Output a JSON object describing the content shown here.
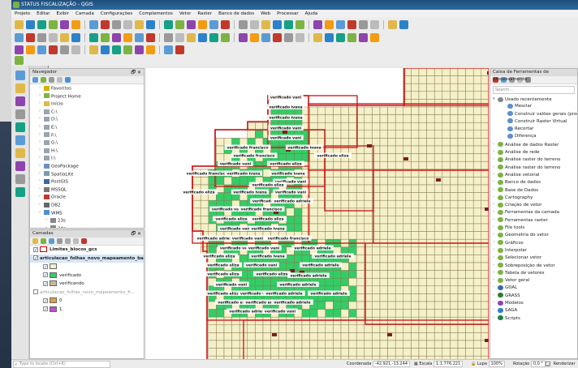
{
  "window": {
    "title": "STATUS FISCALIZAÇÃO - QGIS"
  },
  "menu": [
    "Projeto",
    "Editar",
    "Exibir",
    "Camada",
    "Configurações",
    "Complementos",
    "Vetor",
    "Raster",
    "Banco de dados",
    "Web",
    "Processar",
    "Ajuda"
  ],
  "navigator": {
    "title": "Navegador",
    "items": [
      {
        "label": "Favoritos",
        "icon": "star-icon",
        "color": "#d9b000",
        "level": 1
      },
      {
        "label": "Project Home",
        "icon": "home-folder-icon",
        "color": "#7cb342",
        "level": 1
      },
      {
        "label": "Início",
        "icon": "folder-icon",
        "color": "#e0b84a",
        "level": 1
      },
      {
        "label": "C:\\",
        "icon": "drive-icon",
        "color": "#9aa4ae",
        "level": 1
      },
      {
        "label": "D:\\",
        "icon": "drive-icon",
        "color": "#9aa4ae",
        "level": 1
      },
      {
        "label": "E:\\",
        "icon": "drive-icon",
        "color": "#9aa4ae",
        "level": 1
      },
      {
        "label": "F:\\",
        "icon": "drive-icon",
        "color": "#9aa4ae",
        "level": 1
      },
      {
        "label": "G:\\",
        "icon": "drive-icon",
        "color": "#9aa4ae",
        "level": 1
      },
      {
        "label": "H:\\",
        "icon": "drive-icon",
        "color": "#9aa4ae",
        "level": 1
      },
      {
        "label": "I:\\",
        "icon": "drive-icon",
        "color": "#9aa4ae",
        "level": 1
      },
      {
        "label": "GeoPackage",
        "icon": "geopackage-icon",
        "color": "#6b8fc7",
        "level": 1
      },
      {
        "label": "SpatiaLite",
        "icon": "spatialite-icon",
        "color": "#7b9bb0",
        "level": 1
      },
      {
        "label": "PostGIS",
        "icon": "postgis-icon",
        "color": "#3a6aa3",
        "level": 1
      },
      {
        "label": "MSSQL",
        "icon": "mssql-icon",
        "color": "#777777",
        "level": 1
      },
      {
        "label": "Oracle",
        "icon": "oracle-icon",
        "color": "#c0392b",
        "level": 1
      },
      {
        "label": "DB2",
        "icon": "db2-icon",
        "color": "#666666",
        "level": 1
      },
      {
        "label": "WMS",
        "icon": "globe-icon",
        "color": "#4a90d9",
        "level": 1
      },
      {
        "label": "23s",
        "icon": "layer-icon",
        "color": "#888888",
        "level": 2
      },
      {
        "label": "24s",
        "icon": "layer-icon",
        "color": "#888888",
        "level": 2
      }
    ]
  },
  "layers_panel": {
    "title": "Camadas",
    "layers": [
      {
        "label": "Limites_blocos_gcs",
        "checked": true,
        "swatch": "#ffffff",
        "border": "#c00000",
        "level": 0,
        "bold": true
      },
      {
        "label": "articulacao_folhas_novo_mapeamento_ba",
        "checked": true,
        "swatch": null,
        "level": 0,
        "bold": true
      },
      {
        "label": "",
        "checked": true,
        "swatch": "#f4f0c8",
        "level": 1
      },
      {
        "label": "verificado",
        "checked": true,
        "swatch": "#33cc66",
        "level": 1
      },
      {
        "label": "verificando",
        "checked": true,
        "swatch": "#c9b896",
        "level": 1
      },
      {
        "label": "articulacao_folhas_novo_mapeamento_fi...",
        "checked": false,
        "swatch": null,
        "level": 0,
        "bold": false,
        "muted": true
      },
      {
        "label": "0",
        "checked": true,
        "swatch": "#e0a040",
        "level": 1
      },
      {
        "label": "1",
        "checked": true,
        "swatch": "#c050d0",
        "level": 1
      }
    ]
  },
  "toolbox": {
    "title": "Caixa de Ferramentas de processamento",
    "search_placeholder": "Search...",
    "items": [
      {
        "label": "Usado recentemente",
        "level": 0,
        "icon": "recent-icon",
        "color": "#888888",
        "open": true
      },
      {
        "label": "Mesclar",
        "level": 1,
        "icon": "tool-icon",
        "color": "#5b8fd0"
      },
      {
        "label": "Construir valões gerais (proced)",
        "level": 1,
        "icon": "tool-icon",
        "color": "#5b8fd0"
      },
      {
        "label": "Construir Raster Virtual",
        "level": 1,
        "icon": "tool-icon",
        "color": "#5b8fd0"
      },
      {
        "label": "Recortar",
        "level": 1,
        "icon": "tool-icon",
        "color": "#5b8fd0"
      },
      {
        "label": "Diferença",
        "level": 1,
        "icon": "tool-icon",
        "color": "#5b8fd0"
      },
      {
        "label": "Análise de dados Raster",
        "level": 0,
        "icon": "qgis-icon",
        "color": "#7cb342"
      },
      {
        "label": "Análise de rede",
        "level": 0,
        "icon": "qgis-icon",
        "color": "#7cb342"
      },
      {
        "label": "Análise raster do terreno",
        "level": 0,
        "icon": "qgis-icon",
        "color": "#7cb342"
      },
      {
        "label": "Análise raster do terreno",
        "level": 0,
        "icon": "qgis-icon",
        "color": "#7cb342"
      },
      {
        "label": "Análise vetorial",
        "level": 0,
        "icon": "qgis-icon",
        "color": "#7cb342"
      },
      {
        "label": "Banco de dados",
        "level": 0,
        "icon": "qgis-icon",
        "color": "#7cb342"
      },
      {
        "label": "Base de Dados",
        "level": 0,
        "icon": "qgis-icon",
        "color": "#7cb342"
      },
      {
        "label": "Cartography",
        "level": 0,
        "icon": "qgis-icon",
        "color": "#7cb342"
      },
      {
        "label": "Criação de vetor",
        "level": 0,
        "icon": "qgis-icon",
        "color": "#7cb342"
      },
      {
        "label": "Ferramentas da camada",
        "level": 0,
        "icon": "qgis-icon",
        "color": "#7cb342"
      },
      {
        "label": "Ferramentas raster",
        "level": 0,
        "icon": "qgis-icon",
        "color": "#7cb342"
      },
      {
        "label": "File tools",
        "level": 0,
        "icon": "qgis-icon",
        "color": "#7cb342"
      },
      {
        "label": "Geometria do vetor",
        "level": 0,
        "icon": "qgis-icon",
        "color": "#7cb342"
      },
      {
        "label": "Gráficos",
        "level": 0,
        "icon": "qgis-icon",
        "color": "#7cb342"
      },
      {
        "label": "Interpolar",
        "level": 0,
        "icon": "qgis-icon",
        "color": "#7cb342"
      },
      {
        "label": "Selecionar vetor",
        "level": 0,
        "icon": "qgis-icon",
        "color": "#7cb342"
      },
      {
        "label": "Sobreposição de vetor",
        "level": 0,
        "icon": "qgis-icon",
        "color": "#7cb342"
      },
      {
        "label": "Tabela de vetores",
        "level": 0,
        "icon": "qgis-icon",
        "color": "#7cb342"
      },
      {
        "label": "Vetor geral",
        "level": 0,
        "icon": "qgis-icon",
        "color": "#7cb342"
      },
      {
        "label": "GDAL",
        "level": 0,
        "icon": "gdal-icon",
        "color": "#3a6aa3"
      },
      {
        "label": "GRASS",
        "level": 0,
        "icon": "grass-icon",
        "color": "#2e7d32"
      },
      {
        "label": "Modelos",
        "level": 0,
        "icon": "model-icon",
        "color": "#8e44ad"
      },
      {
        "label": "SAGA",
        "level": 0,
        "icon": "saga-icon",
        "color": "#2c82c9"
      },
      {
        "label": "Scripts",
        "level": 0,
        "icon": "script-icon",
        "color": "#1e8449"
      }
    ]
  },
  "map": {
    "cell_label": "verificado",
    "labels": [
      [
        "verificado vani",
        352,
        120
      ],
      [
        "verificado ivana",
        352,
        132
      ],
      [
        "verificado ivana",
        352,
        145
      ],
      [
        "verificado vani",
        352,
        158
      ],
      [
        "verificado vani",
        352,
        170
      ],
      [
        "verificado francisco",
        305,
        182
      ],
      [
        "verificado ivana",
        375,
        182
      ],
      [
        "verificado francisco",
        313,
        192
      ],
      [
        "verificado eliza",
        410,
        192
      ],
      [
        "verificado vani",
        290,
        202
      ],
      [
        "verificado eliza",
        352,
        202
      ],
      [
        "verificado francisco",
        255,
        214
      ],
      [
        "verificado ivana",
        300,
        214
      ],
      [
        "verificado ivana",
        355,
        214
      ],
      [
        "verificado vani",
        358,
        224
      ],
      [
        "verificado eliza",
        330,
        228
      ],
      [
        "verificado eliza",
        245,
        237
      ],
      [
        "verificado ivana",
        308,
        237
      ],
      [
        "verificado vani",
        358,
        237
      ],
      [
        "verificado vani",
        330,
        248
      ],
      [
        "verificado adriele",
        360,
        248
      ],
      [
        "verificado vani",
        280,
        258
      ],
      [
        "verificado francisco",
        322,
        258
      ],
      [
        "verificado eliza",
        285,
        270
      ],
      [
        "verificado eliza",
        330,
        270
      ],
      [
        "verificado vani",
        290,
        282
      ],
      [
        "verificado ivana",
        330,
        282
      ],
      [
        "verificado adriele",
        265,
        294
      ],
      [
        "verificado vani",
        305,
        294
      ],
      [
        "verificado francisco",
        355,
        294
      ],
      [
        "verificado vani",
        290,
        306
      ],
      [
        "verificado vani",
        325,
        306
      ],
      [
        "verificado adriele",
        385,
        306
      ],
      [
        "verificado eliza",
        270,
        316
      ],
      [
        "verificado ivana",
        330,
        316
      ],
      [
        "verificado adriele",
        410,
        316
      ],
      [
        "verificado eliza",
        275,
        327
      ],
      [
        "verificado vani",
        322,
        327
      ],
      [
        "verificado adriele",
        395,
        327
      ],
      [
        "verificado eliza",
        275,
        338
      ],
      [
        "verificado eliza",
        335,
        338
      ],
      [
        "verificado adriele",
        380,
        340
      ],
      [
        "verificado vani",
        285,
        351
      ],
      [
        "verificado adriele",
        367,
        351
      ],
      [
        "verificado eliza",
        275,
        362
      ],
      [
        "verificado vani",
        315,
        362
      ],
      [
        "verificado adriele",
        350,
        362
      ],
      [
        "verificado adriele",
        405,
        362
      ],
      [
        "verificado eliza",
        288,
        373
      ],
      [
        "verificado adriele",
        325,
        373
      ],
      [
        "verificado adriele",
        360,
        373
      ],
      [
        "verificado adriele",
        305,
        384
      ],
      [
        "verificado vani",
        345,
        384
      ]
    ]
  },
  "status": {
    "locator_placeholder": "Type to locate (Ctrl+K)",
    "coordinate_label": "Coordenada",
    "coordinate_value": "-42.921,-13.244",
    "scale_label": "Escala",
    "scale_value": "1:1.776.221",
    "magnifier_label": "Lupa",
    "magnifier_value": "100%",
    "rotation_label": "Rotação",
    "rotation_value": "0,0 °",
    "render_label": "Renderizar"
  },
  "colors": {
    "verificado": "#33cc66",
    "verificando": "#c9b896",
    "grid": "#8a7a55",
    "cell": "#f4f0c8",
    "block_border": "#cc1111"
  }
}
